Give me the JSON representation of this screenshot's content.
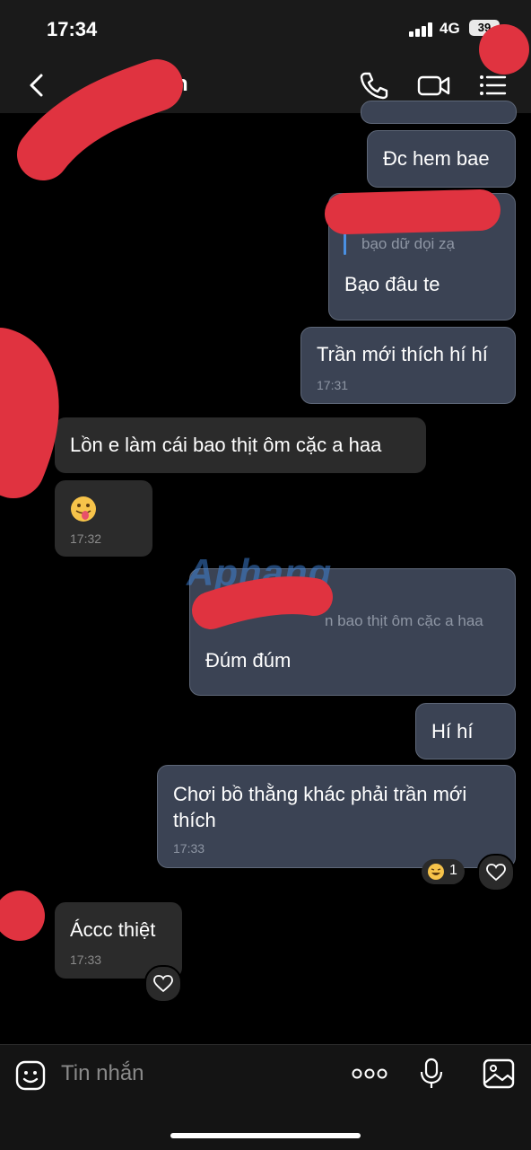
{
  "status_bar": {
    "time": "17:34",
    "network": "4G",
    "battery": "39"
  },
  "header": {
    "contact_name_visible": "h"
  },
  "messages": {
    "m1": "Đc hem bae",
    "m2_quote": "bạo dữ dọi zạ",
    "m2_text": "Bạo đâu te",
    "m3_text": "Trần mới thích hí hí",
    "m3_time": "17:31",
    "m4_text": "Lồn e làm cái bao thịt ôm cặc a haa",
    "m5_time": "17:32",
    "m6_quote": "n bao thịt ôm cặc a haa",
    "m6_text": "Đúm đúm",
    "m7_text": "Hí hí",
    "m8_text": "Chơi bồ thằng khác phải trần mới thích",
    "m8_time": "17:33",
    "m8_reaction_count": "1",
    "m9_text": "Áccc thiệt",
    "m9_time": "17:33"
  },
  "watermark": "Aphang",
  "composer": {
    "placeholder": "Tin nhắn"
  }
}
